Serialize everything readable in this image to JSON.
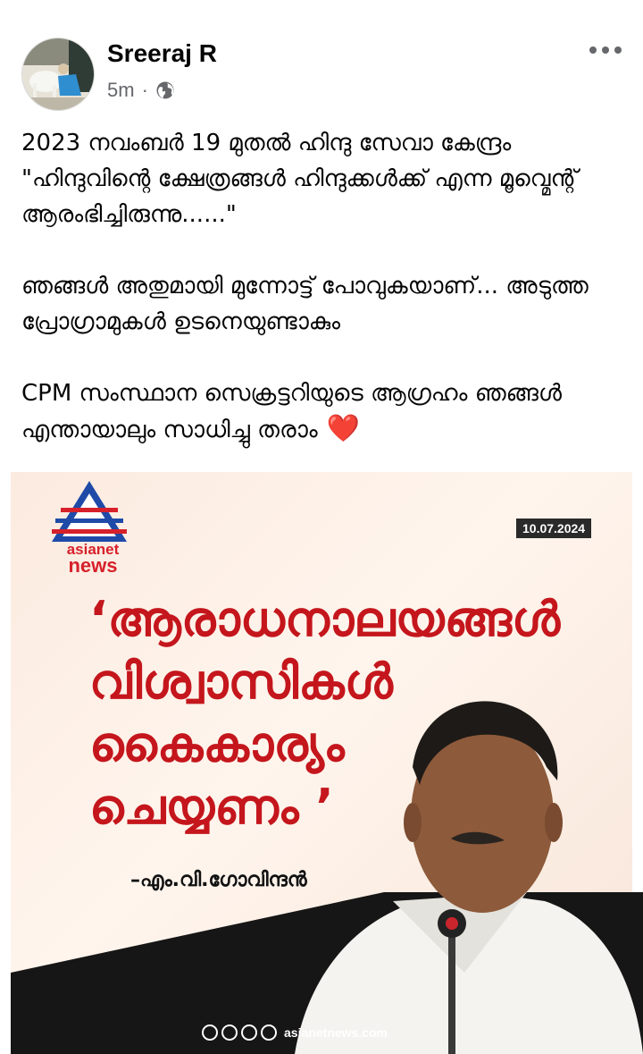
{
  "post": {
    "author": "Sreeraj R",
    "time": "5m",
    "separator": "·",
    "paragraphs": [
      "2023 നവംബർ 19 മുതൽ ഹിന്ദു സേവാ കേന്ദ്രം \"ഹിന്ദുവിന്റെ ക്ഷേത്രങ്ങൾ ഹിന്ദുക്കൾക്ക് എന്ന മൂവ്മെന്റ് ആരംഭിച്ചിരുന്നു......\"",
      "ഞങ്ങൾ അതുമായി മുന്നോട്ട് പോവുകയാണ്... അടുത്ത പ്രോഗ്രാമുകൾ ഉടനെയുണ്ടാകും",
      "CPM സംസ്ഥാന സെക്രട്ടറിയുടെ ആഗ്രഹം ഞങ്ങൾ എന്തായാലും സാധിച്ചു തരാം"
    ],
    "emoji": "❤️"
  },
  "media": {
    "logo_line1": "asianet",
    "logo_line2": "news",
    "date": "10.07.2024",
    "quote_lines": [
      "‘ആരാധനാലയങ്ങൾ",
      "വിശ്വാസികൾ",
      "കൈകാര്യം",
      "ചെയ്യണം ’"
    ],
    "attribution": "–എം.വി.ഗോവിന്ദൻ",
    "footer": "asianetnews.com"
  },
  "icons": {
    "privacy": "globe-icon",
    "menu": "more-options-icon"
  },
  "colors": {
    "quote_red": "#c4161c",
    "logo_blue": "#1f4aa8",
    "logo_red": "#d6212b",
    "meta_gray": "#65676b"
  }
}
